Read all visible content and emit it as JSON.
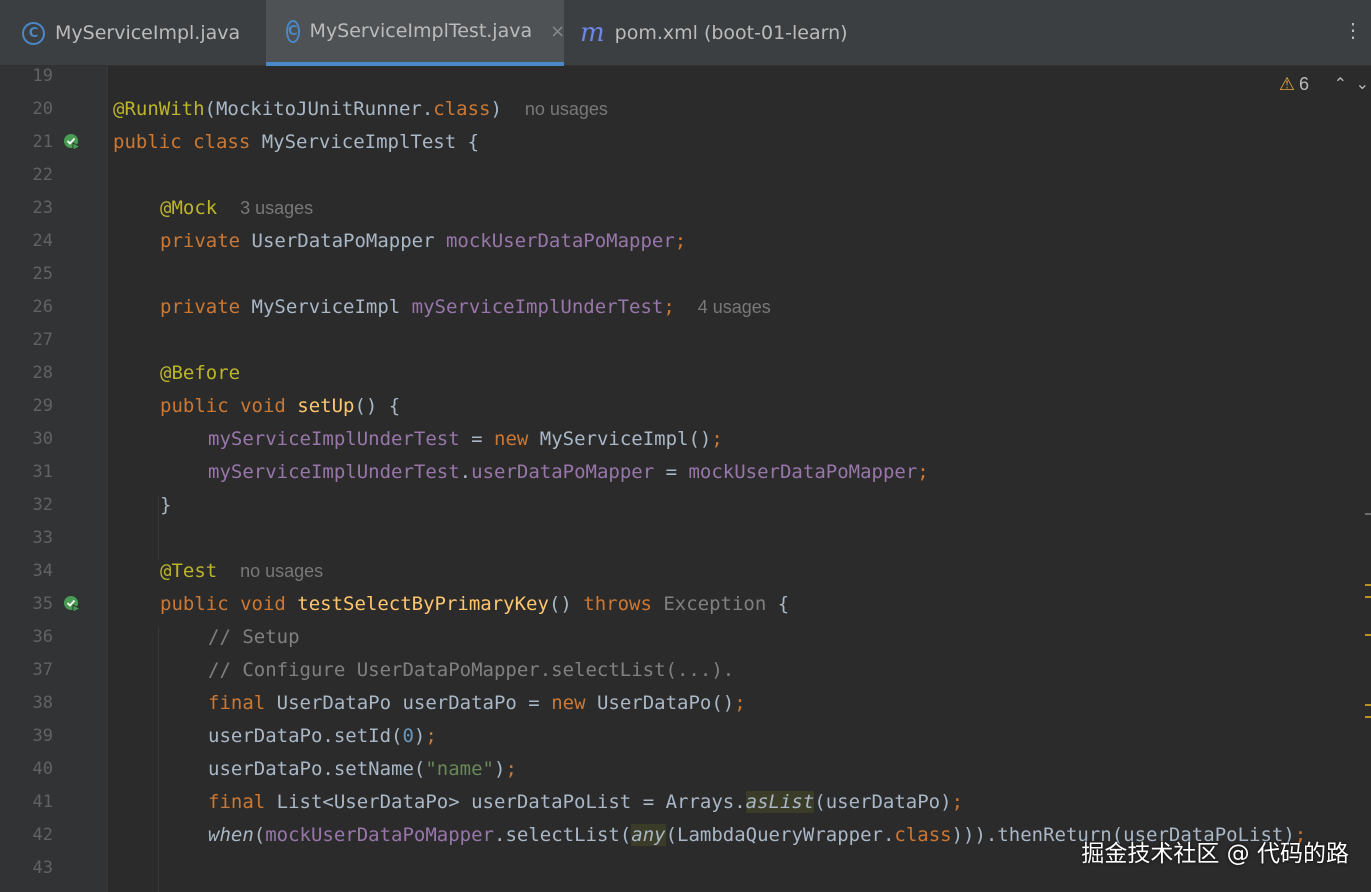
{
  "tabs": [
    {
      "label": "MyServiceImpl.java",
      "icon": "class-icon"
    },
    {
      "label": "MyServiceImplTest.java",
      "icon": "class-icon",
      "active": true,
      "close": "×"
    },
    {
      "label": "pom.xml (boot-01-learn)",
      "icon": "maven-m-icon",
      "icon_glyph": "m"
    }
  ],
  "more_glyph": "⋮",
  "inspections": {
    "warning_count": "6",
    "warning_glyph": "⚠",
    "up_glyph": "⌃",
    "down_glyph": "⌄"
  },
  "lines": [
    {
      "n": "19"
    },
    {
      "n": "20",
      "hint": "no usages"
    },
    {
      "n": "21",
      "run": true
    },
    {
      "n": "22"
    },
    {
      "n": "23",
      "hint": "3 usages"
    },
    {
      "n": "24"
    },
    {
      "n": "25"
    },
    {
      "n": "26",
      "hint": "4 usages"
    },
    {
      "n": "27"
    },
    {
      "n": "28"
    },
    {
      "n": "29"
    },
    {
      "n": "30"
    },
    {
      "n": "31"
    },
    {
      "n": "32"
    },
    {
      "n": "33"
    },
    {
      "n": "34",
      "hint": "no usages"
    },
    {
      "n": "35",
      "run": true
    },
    {
      "n": "36"
    },
    {
      "n": "37"
    },
    {
      "n": "38"
    },
    {
      "n": "39"
    },
    {
      "n": "40"
    },
    {
      "n": "41"
    },
    {
      "n": "42"
    },
    {
      "n": "43"
    }
  ],
  "code": {
    "l20": [
      "@RunWith",
      "(MockitoJUnitRunner.",
      "class",
      ")"
    ],
    "l21": [
      "public class ",
      "MyServiceImplTest {"
    ],
    "l23": [
      "@Mock"
    ],
    "l24": [
      "private ",
      "UserDataPoMapper ",
      "mockUserDataPoMapper",
      ";"
    ],
    "l26": [
      "private ",
      "MyServiceImpl ",
      "myServiceImplUnderTest",
      ";"
    ],
    "l28": [
      "@Before"
    ],
    "l29": [
      "public void ",
      "setUp",
      "() {"
    ],
    "l30": [
      "myServiceImplUnderTest",
      " = ",
      "new ",
      "MyServiceImpl()",
      ";"
    ],
    "l31": [
      "myServiceImplUnderTest",
      ".",
      "userDataPoMapper",
      " = ",
      "mockUserDataPoMapper",
      ";"
    ],
    "l32": [
      "}"
    ],
    "l34": [
      "@Test"
    ],
    "l35": [
      "public void ",
      "testSelectByPrimaryKey",
      "() ",
      "throws ",
      "Exception",
      " {"
    ],
    "l36": [
      "// Setup"
    ],
    "l37": [
      "// Configure UserDataPoMapper.selectList(...)."
    ],
    "l38": [
      "final ",
      "UserDataPo userDataPo = ",
      "new ",
      "UserDataPo()",
      ";"
    ],
    "l39": [
      "userDataPo.setId(",
      "0",
      ")",
      ";"
    ],
    "l40": [
      "userDataPo.setName(",
      "\"name\"",
      ")",
      ";"
    ],
    "l41": [
      "final ",
      "List<UserDataPo> userDataPoList = Arrays.",
      "asList",
      "(userDataPo)",
      ";"
    ],
    "l42": [
      "when",
      "(",
      "mockUserDataPoMapper",
      ".selectList(",
      "any",
      "(LambdaQueryWrapper.",
      "class",
      "))).thenReturn(userDataPoList)",
      ";"
    ]
  },
  "watermark": "掘金技术社区 @ 代码的路"
}
